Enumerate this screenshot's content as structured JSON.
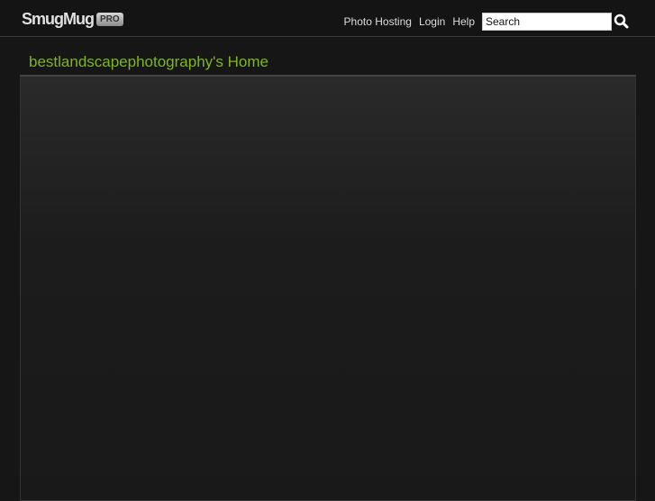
{
  "header": {
    "logo": "SmugMug",
    "logo_badge": "PRO",
    "nav": [
      "Photo Hosting",
      "Login",
      "Help"
    ],
    "search_value": "Search"
  },
  "page": {
    "title": "bestlandscapephotography's Home"
  }
}
